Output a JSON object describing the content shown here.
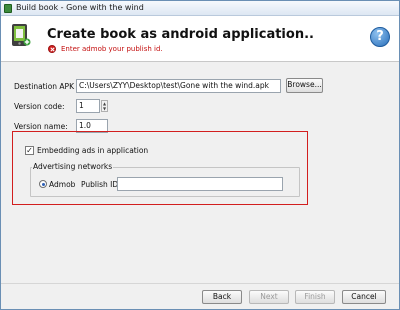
{
  "window": {
    "title": "Build book - Gone with the wind"
  },
  "header": {
    "title": "Create book as android application..",
    "error": "Enter admob your publish id."
  },
  "form": {
    "apk_label": "Destination APK file:",
    "apk_value": "C:\\Users\\ZYY\\Desktop\\test\\Gone with the wind.apk",
    "browse_label": "Browse...",
    "version_code_label": "Version code:",
    "version_code_value": "1",
    "version_name_label": "Version name:",
    "version_name_value": "1.0"
  },
  "ads": {
    "embed_label": "Embedding ads in application",
    "embed_checked": true,
    "group_title": "Advertising networks",
    "network_option": "Admob",
    "publish_id_label": "Publish ID:",
    "publish_id_value": ""
  },
  "footer": {
    "back": "Back",
    "next": "Next",
    "finish": "Finish",
    "cancel": "Cancel"
  }
}
